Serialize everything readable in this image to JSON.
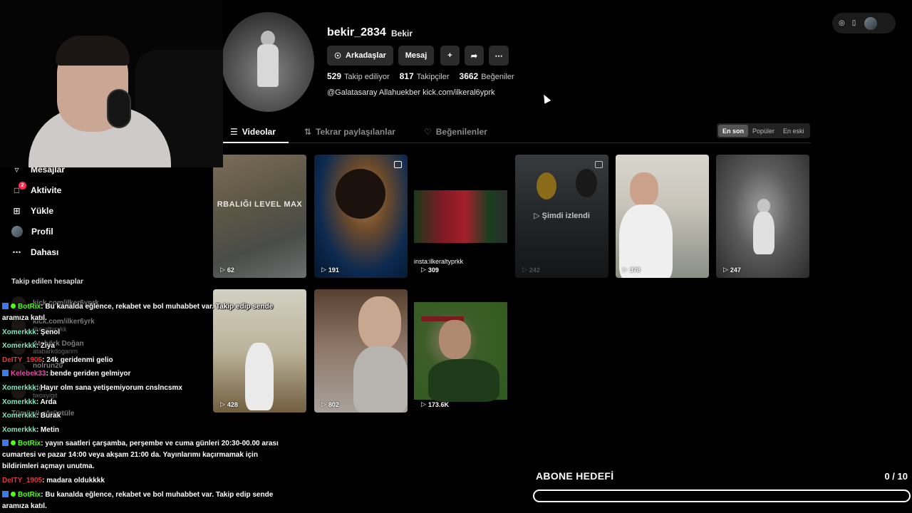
{
  "profile": {
    "username": "bekir_2834",
    "nickname": "Bekir",
    "buttons": {
      "friends": "Arkadaşlar",
      "message": "Mesaj"
    },
    "stats": [
      {
        "value": "529",
        "label": "Takip ediliyor"
      },
      {
        "value": "817",
        "label": "Takipçiler"
      },
      {
        "value": "3662",
        "label": "Beğeniler"
      }
    ],
    "bio": "@Galatasaray Allahuekber kick.com/ilkeral6yprk"
  },
  "tabs": [
    {
      "label": "Videolar"
    },
    {
      "label": "Tekrar paylaşılanlar"
    },
    {
      "label": "Beğenilenler"
    }
  ],
  "sort": {
    "options": [
      "En son",
      "Popüler",
      "En eski"
    ],
    "selected": "En son"
  },
  "videos": [
    {
      "views": "62",
      "overlay": "RBALIĞI LEVEL MAX"
    },
    {
      "views": "191"
    },
    {
      "views": "309",
      "caption": "insta:ilkeraltyprkk"
    },
    {
      "views": "242",
      "overlay": "Şimdi izlendi"
    },
    {
      "views": "378"
    },
    {
      "views": "247"
    },
    {
      "views": "428"
    },
    {
      "views": "802"
    },
    {
      "views": "173.6K"
    }
  ],
  "sidebar": {
    "items": [
      {
        "label": "Mesajlar",
        "icon": "message-icon"
      },
      {
        "label": "Aktivite",
        "icon": "activity-icon",
        "badge": "2"
      },
      {
        "label": "Yükle",
        "icon": "upload-icon"
      },
      {
        "label": "Profil",
        "icon": "profile-avatar"
      },
      {
        "label": "Dahası",
        "icon": "more-icon"
      }
    ],
    "followed_title": "Takip edilen hesaplar",
    "followed": [
      {
        "name": "kick.com/ilker6yprk",
        "handle": ""
      },
      {
        "name": "kick.com/ilker6yrk",
        "handle": "ilkeraltyprkk"
      },
      {
        "name": "Atabörk Doğan",
        "handle": "atabarkdoganrn"
      },
      {
        "name": "nolrun20",
        "handle": "nolrun20"
      },
      {
        "name": "yiğit",
        "handle": "twoxyigit"
      }
    ],
    "show_all": "Tümünü görüntüle"
  },
  "chat": [
    {
      "user": "BotRix",
      "color": "#53fc18",
      "kick": true,
      "bot": true,
      "text": ": Bu kanalda eğlence, rekabet ve bol muhabbet var. Takip edip sende aramıza katıl."
    },
    {
      "user": "Xomerkkk",
      "color": "#7fe7c4",
      "text": ": Şenol"
    },
    {
      "user": "Xomerkkk",
      "color": "#7fe7c4",
      "text": ": Ziya"
    },
    {
      "user": "DeITY_1905",
      "color": "#e43b3b",
      "text": ": 24k geridenmi gelio"
    },
    {
      "user": "Kelebek33",
      "color": "#e44ba6",
      "kick": true,
      "text": ": bende geriden gelmiyor"
    },
    {
      "user": "Xomerkkk",
      "color": "#7fe7c4",
      "text": ": Hayır olm sana yetişemiyorum cnslncsmx"
    },
    {
      "user": "Xomerkkk",
      "color": "#7fe7c4",
      "text": ": Arda"
    },
    {
      "user": "Xomerkkk",
      "color": "#7fe7c4",
      "text": ": Burak"
    },
    {
      "user": "Xomerkkk",
      "color": "#7fe7c4",
      "text": ": Metin"
    },
    {
      "user": "BotRix",
      "color": "#53fc18",
      "kick": true,
      "bot": true,
      "text": ": yayın saatleri çarşamba, perşembe ve cuma günleri 20:30-00.00 arası cumartesi ve pazar 14:00 veya akşam 21:00 da. Yayınlarımı kaçırmamak için bildirimleri açmayı unutma."
    },
    {
      "user": "DeITY_1905",
      "color": "#e43b3b",
      "text": ": madara oldukkkk"
    },
    {
      "user": "BotRix",
      "color": "#53fc18",
      "kick": true,
      "bot": true,
      "text": ": Bu kanalda eğlence, rekabet ve bol muhabbet var. Takip edip sende aramıza katıl."
    }
  ],
  "goal": {
    "title": "ABONE HEDEFİ",
    "count": "0 / 10",
    "progress": 0
  }
}
